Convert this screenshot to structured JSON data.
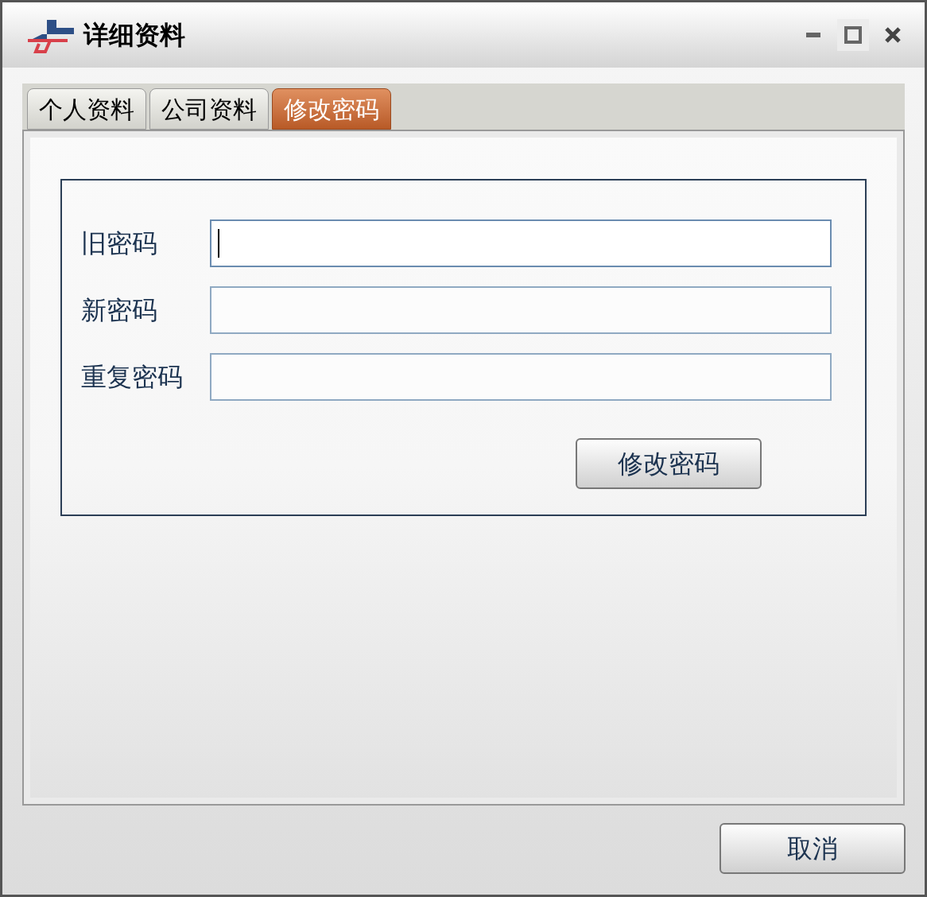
{
  "window": {
    "title": "详细资料"
  },
  "tabs": [
    {
      "label": "个人资料",
      "selected": false
    },
    {
      "label": "公司资料",
      "selected": false
    },
    {
      "label": "修改密码",
      "selected": true
    }
  ],
  "fields": [
    {
      "label": "旧密码",
      "focused": true
    },
    {
      "label": "新密码",
      "focused": false
    },
    {
      "label": "重复密码",
      "focused": false
    }
  ],
  "submit_button": "修改密码",
  "cancel_button": "取消"
}
